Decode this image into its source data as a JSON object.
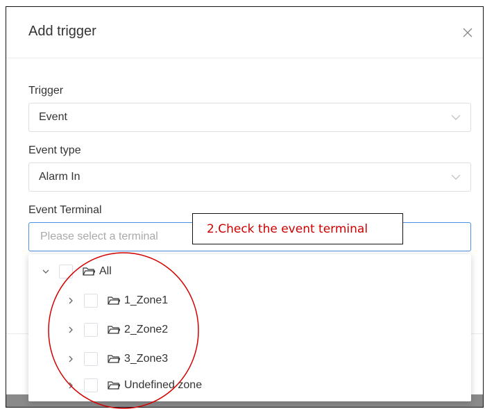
{
  "dialog": {
    "title": "Add trigger",
    "close_icon": "close-icon"
  },
  "trigger": {
    "label": "Trigger",
    "value": "Event"
  },
  "event_type": {
    "label": "Event type",
    "value": "Alarm In"
  },
  "event_terminal": {
    "label": "Event Terminal",
    "placeholder": "Please select a terminal"
  },
  "tree": {
    "root": {
      "label": "All",
      "expanded": true
    },
    "children": [
      {
        "label": "1_Zone1"
      },
      {
        "label": "2_Zone2"
      },
      {
        "label": "3_Zone3"
      },
      {
        "label": "Undefined zone"
      }
    ]
  },
  "annotation": {
    "callout_text": "2.Check the event terminal",
    "callout_color": "#cc0000",
    "accent_color": "#4a90e2"
  }
}
